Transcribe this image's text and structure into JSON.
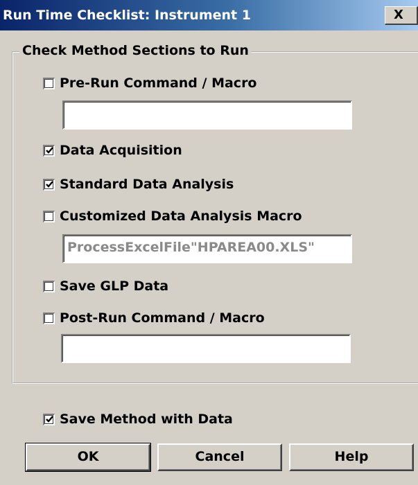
{
  "window": {
    "title": "Run Time Checklist: Instrument 1",
    "close_label": "X"
  },
  "group": {
    "legend": "Check Method Sections to Run"
  },
  "options": {
    "pre_run": {
      "label": "Pre-Run Command / Macro",
      "checked": false
    },
    "pre_run_field": {
      "value": ""
    },
    "data_acquisition": {
      "label": "Data Acquisition",
      "checked": true
    },
    "standard_analysis": {
      "label": "Standard Data Analysis",
      "checked": true
    },
    "custom_macro": {
      "label": "Customized Data Analysis Macro",
      "checked": false
    },
    "custom_macro_field": {
      "value": "ProcessExcelFile\"HPAREA00.XLS\""
    },
    "save_glp": {
      "label": "Save GLP Data",
      "checked": false
    },
    "post_run": {
      "label": "Post-Run Command / Macro",
      "checked": false
    },
    "post_run_field": {
      "value": ""
    },
    "save_method": {
      "label": "Save Method with Data",
      "checked": true
    }
  },
  "buttons": {
    "ok": "OK",
    "cancel": "Cancel",
    "help": "Help"
  },
  "colors": {
    "face": "#d4d0c8",
    "title_start": "#0a246a",
    "title_end": "#a6caf0"
  }
}
